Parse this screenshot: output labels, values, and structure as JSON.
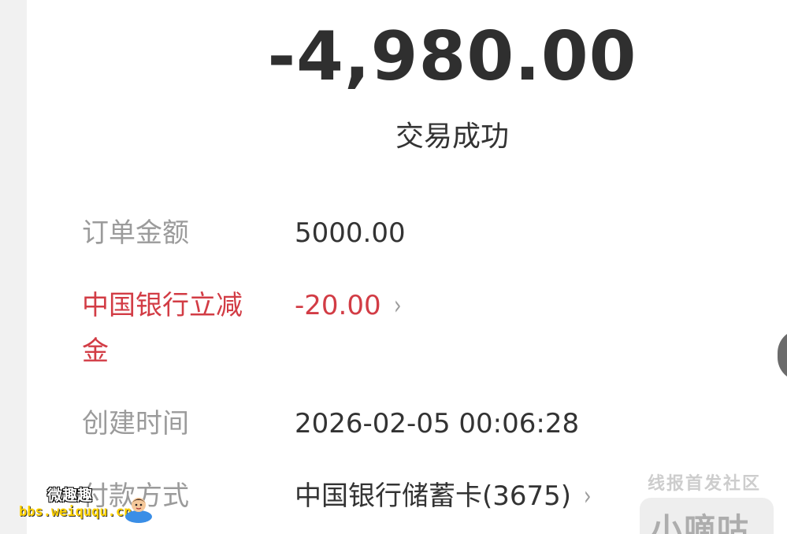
{
  "amount": "-4,980.00",
  "status": "交易成功",
  "rows": [
    {
      "label": "订单金额",
      "value": "5000.00"
    },
    {
      "label_line1": "中国银行立减",
      "label_line2": "金",
      "value": "-20.00"
    },
    {
      "label": "创建时间",
      "value": "2026-02-05 00:06:28"
    },
    {
      "label": "付款方式",
      "value": "中国银行储蓄卡(3675)"
    }
  ],
  "chevron": "›",
  "watermarks": {
    "right_top": "线报首发社区",
    "right_main": "小嘀咕",
    "left_top": "微趣趣",
    "left_url": "bbs.weiququ.cn"
  },
  "colors": {
    "amount": "#2f2f2f",
    "label": "#9b9b9b",
    "value": "#333333",
    "discount_red": "#d23c45",
    "watermark_url": "#ffd200"
  }
}
